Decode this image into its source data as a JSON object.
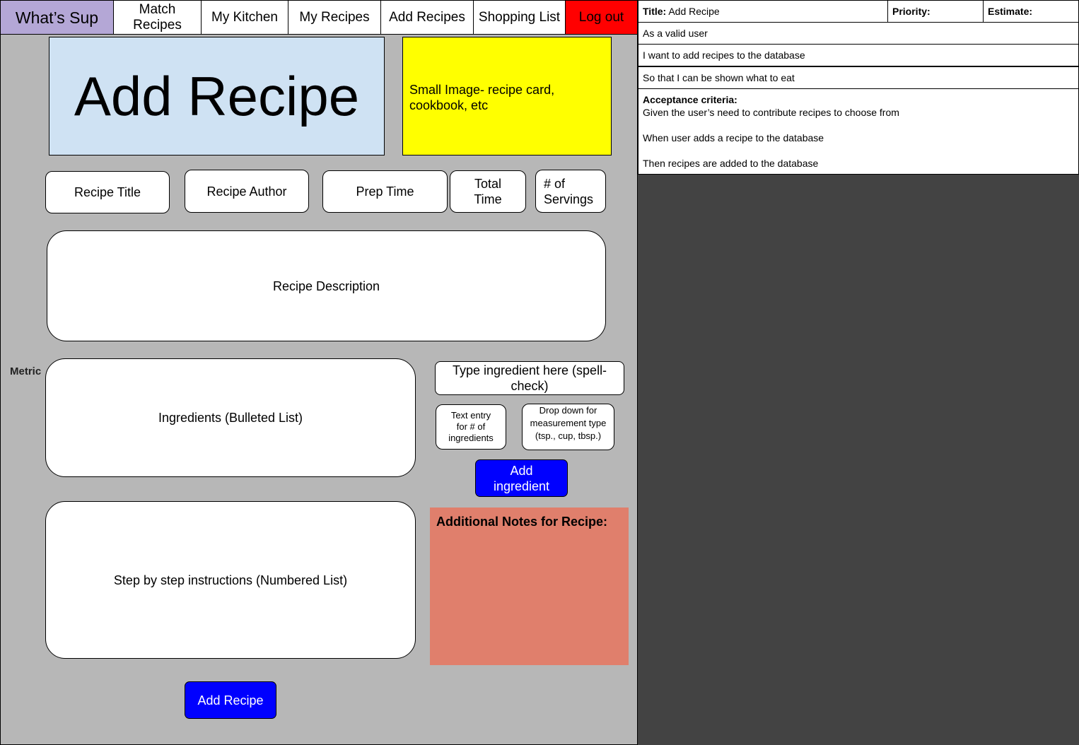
{
  "nav": {
    "brand": "What’s Sup",
    "match_recipes": "Match Recipes",
    "my_kitchen": "My Kitchen",
    "my_recipes": "My Recipes",
    "add_recipes": "Add Recipes",
    "shopping_list": "Shopping List",
    "log_out": "Log out"
  },
  "header": {
    "title": "Add Recipe",
    "image_placeholder": "Small Image- recipe card, cookbook, etc"
  },
  "fields": {
    "recipe_title": "Recipe Title",
    "recipe_author": "Recipe Author",
    "prep_time": "Prep Time",
    "total_time": "Total Time",
    "servings": "# of Servings",
    "description": "Recipe Description",
    "ingredients": "Ingredients (Bulleted List)",
    "instructions": "Step by step instructions (Numbered List)"
  },
  "ingredient_entry": {
    "metric_label": "Metric",
    "type_ingredient": "Type ingredient here (spell-check)",
    "quantity_entry": "Text entry for # of ingredients",
    "measurement_dropdown": "Drop down for measurement type (tsp., cup, tbsp.)",
    "add_ingredient": "Add ingredient"
  },
  "notes": {
    "label": "Additional Notes for Recipe:"
  },
  "submit": {
    "label": "Add Recipe"
  },
  "story": {
    "title_label": "Title:",
    "title_value": "Add Recipe",
    "priority_label": "Priority:",
    "estimate_label": "Estimate:",
    "as_a": "As a valid user",
    "i_want": "I want to add recipes to the database",
    "so_that": "So that I can be shown what to eat",
    "acceptance_label": "Acceptance criteria:",
    "given": "Given the user’s need to contribute recipes to choose from",
    "when": "When user adds a recipe to the database",
    "then": "Then recipes are added to the database"
  }
}
